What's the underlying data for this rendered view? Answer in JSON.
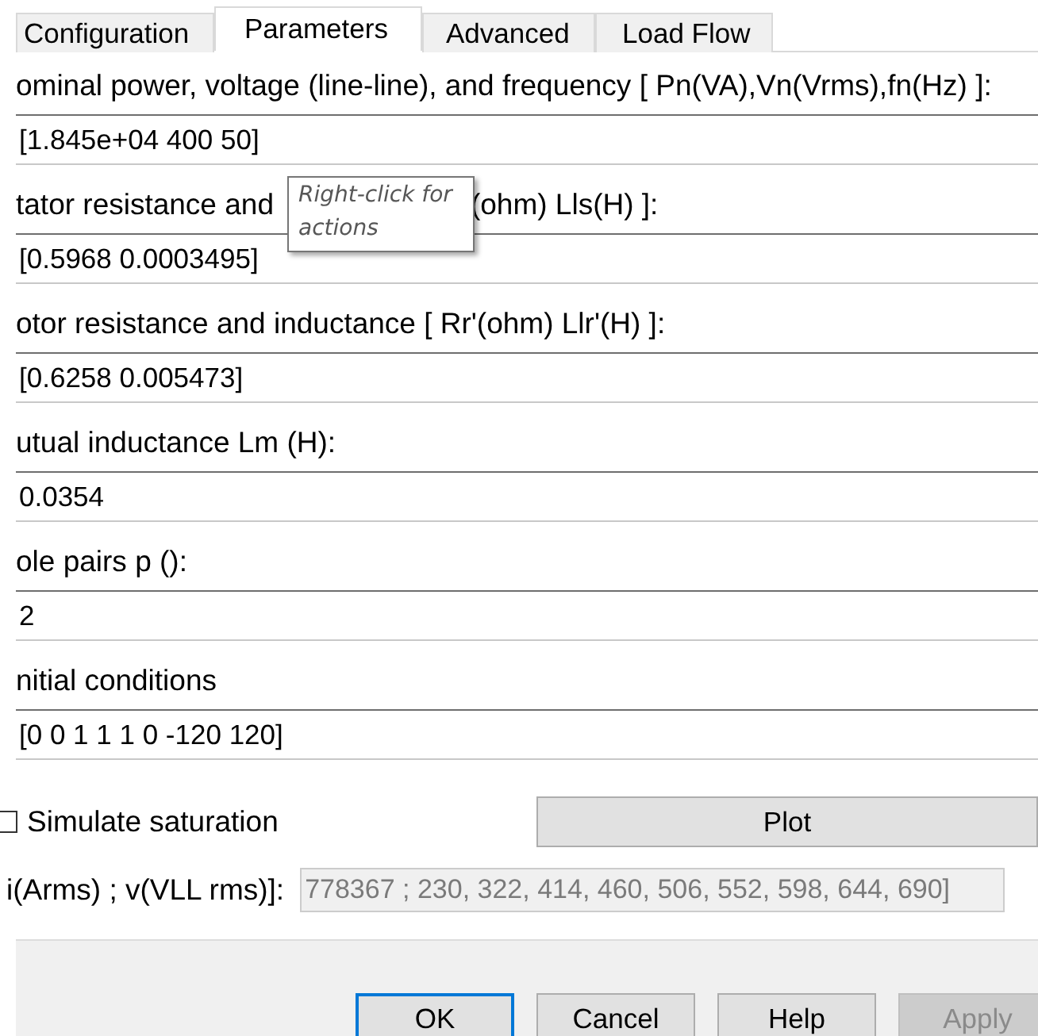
{
  "tabs": [
    {
      "label": "Configuration",
      "selected": false
    },
    {
      "label": "Parameters",
      "selected": true
    },
    {
      "label": "Advanced",
      "selected": false
    },
    {
      "label": "Load Flow",
      "selected": false
    }
  ],
  "parameters": [
    {
      "label": "ominal power, voltage (line-line), and frequency [ Pn(VA),Vn(Vrms),fn(Hz) ]:",
      "value": "[1.845e+04 400 50]"
    },
    {
      "label": "tator resistance and",
      "label_continued": "(ohm)  Lls(H) ]:",
      "value": "[0.5968 0.0003495]"
    },
    {
      "label": "otor resistance and inductance [ Rr'(ohm)  Llr'(H) ]:",
      "value": "[0.6258 0.005473]"
    },
    {
      "label": "utual inductance Lm (H):",
      "value": "0.0354"
    },
    {
      "label": "ole pairs p ():",
      "value": "2"
    },
    {
      "label": "nitial conditions",
      "value": "[0 0 1 1 1 0 -120 120]"
    }
  ],
  "tooltip": {
    "text": "Right-click for actions"
  },
  "saturation": {
    "label": "Simulate saturation",
    "checked": false,
    "plot_button": "Plot"
  },
  "saturation_data": {
    "label": "i(Arms) ; v(VLL rms)]:",
    "value": "778367 ; 230, 322, 414, 460, 506, 552, 598, 644, 690]",
    "disabled": true
  },
  "buttons": [
    {
      "label": "OK",
      "focused": true,
      "disabled": false
    },
    {
      "label": "Cancel",
      "focused": false,
      "disabled": false
    },
    {
      "label": "Help",
      "focused": false,
      "disabled": false
    },
    {
      "label": "Apply",
      "focused": false,
      "disabled": true
    }
  ]
}
